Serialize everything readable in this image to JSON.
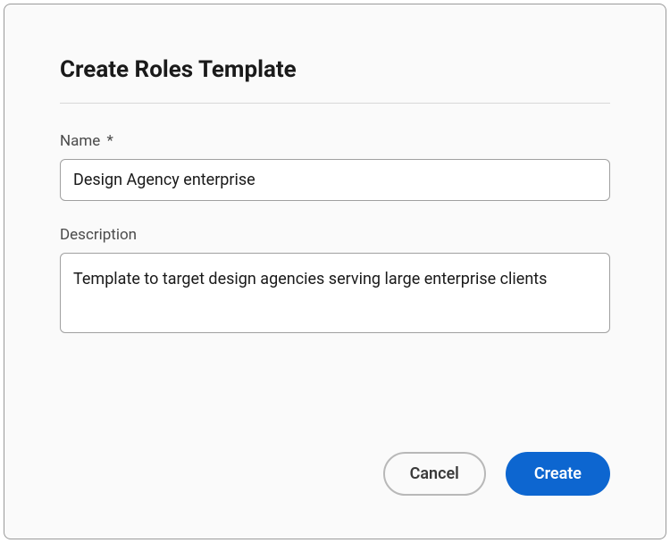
{
  "dialog": {
    "title": "Create Roles Template",
    "fields": {
      "name": {
        "label": "Name",
        "required_marker": "*",
        "value": "Design Agency enterprise"
      },
      "description": {
        "label": "Description",
        "value": "Template to target design agencies serving large enterprise clients"
      }
    },
    "actions": {
      "cancel_label": "Cancel",
      "create_label": "Create"
    }
  }
}
